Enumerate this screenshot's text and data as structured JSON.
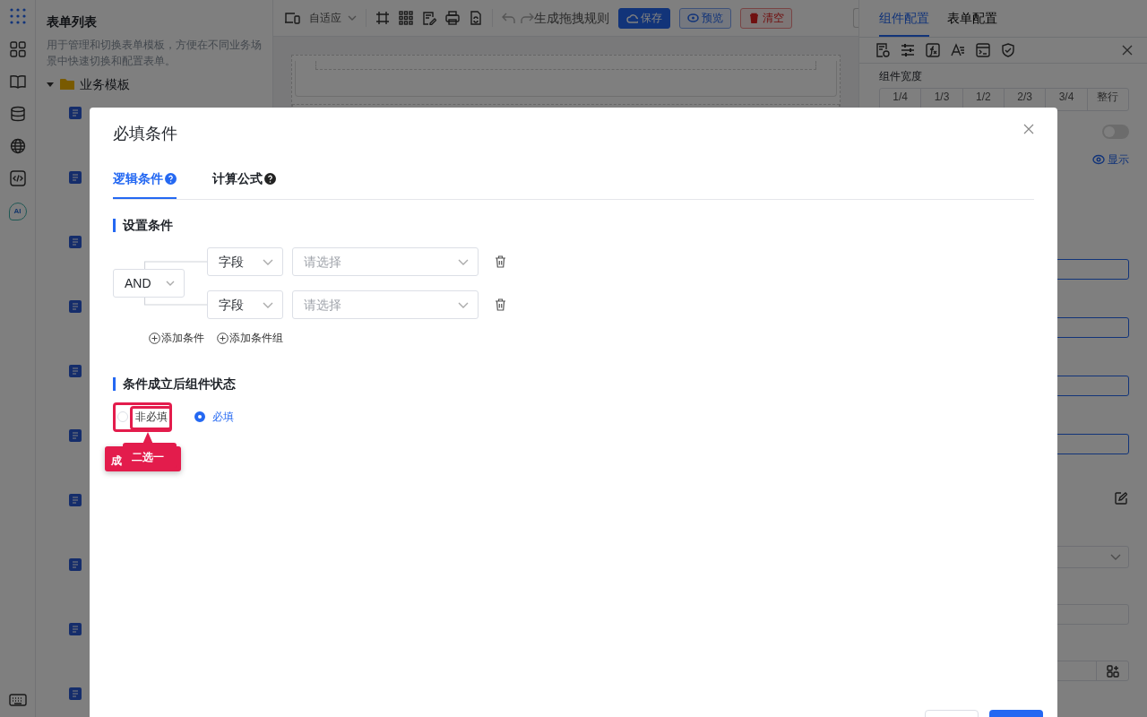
{
  "rail": {
    "ai_label": "AI"
  },
  "left_panel": {
    "title": "表单列表",
    "description": "用于管理和切换表单模板，方便在不同业务场景中快速切换和配置表单。",
    "tree": [
      {
        "label": "业务模板",
        "expanded": true,
        "children": [
          {
            "kind": "document"
          },
          {
            "kind": "document"
          },
          {
            "kind": "document"
          },
          {
            "kind": "document"
          },
          {
            "kind": "document"
          },
          {
            "kind": "document"
          },
          {
            "kind": "document"
          },
          {
            "kind": "document"
          },
          {
            "kind": "document"
          },
          {
            "kind": "document"
          }
        ]
      }
    ]
  },
  "toolbar": {
    "layout_select": "自适应",
    "rule_link": "生成拖拽规则",
    "buttons": [
      {
        "label": "保存",
        "kind": "primary"
      },
      {
        "label": "预览",
        "kind": "outline"
      },
      {
        "label": "清空",
        "kind": "danger"
      }
    ]
  },
  "right_panel": {
    "tabs": [
      {
        "label": "组件配置",
        "selected": true
      },
      {
        "label": "表单配置",
        "selected": false
      }
    ],
    "width_label": "组件宽度",
    "width_options": [
      "1/4",
      "1/3",
      "1/2",
      "2/3",
      "3/4",
      "整行"
    ],
    "toggle": {
      "on": false
    },
    "visibility_link": "显示"
  },
  "dialog": {
    "title": "必填条件",
    "tabs": [
      {
        "label": "逻辑条件",
        "selected": true
      },
      {
        "label": "计算公式",
        "selected": false
      }
    ],
    "condition_section": {
      "title": "设置条件",
      "operator": "AND",
      "rows": [
        {
          "field": "字段",
          "placeholder": "请选择"
        },
        {
          "field": "字段",
          "placeholder": "请选择"
        }
      ],
      "add_actions": [
        "添加条件",
        "添加条件组"
      ]
    },
    "status_section": {
      "title": "条件成立后组件状态",
      "options": [
        {
          "label": "非必填",
          "selected": false
        },
        {
          "label": "必填",
          "selected": true
        }
      ]
    },
    "annotation": {
      "callouts": [
        "成",
        "二选一"
      ]
    }
  }
}
